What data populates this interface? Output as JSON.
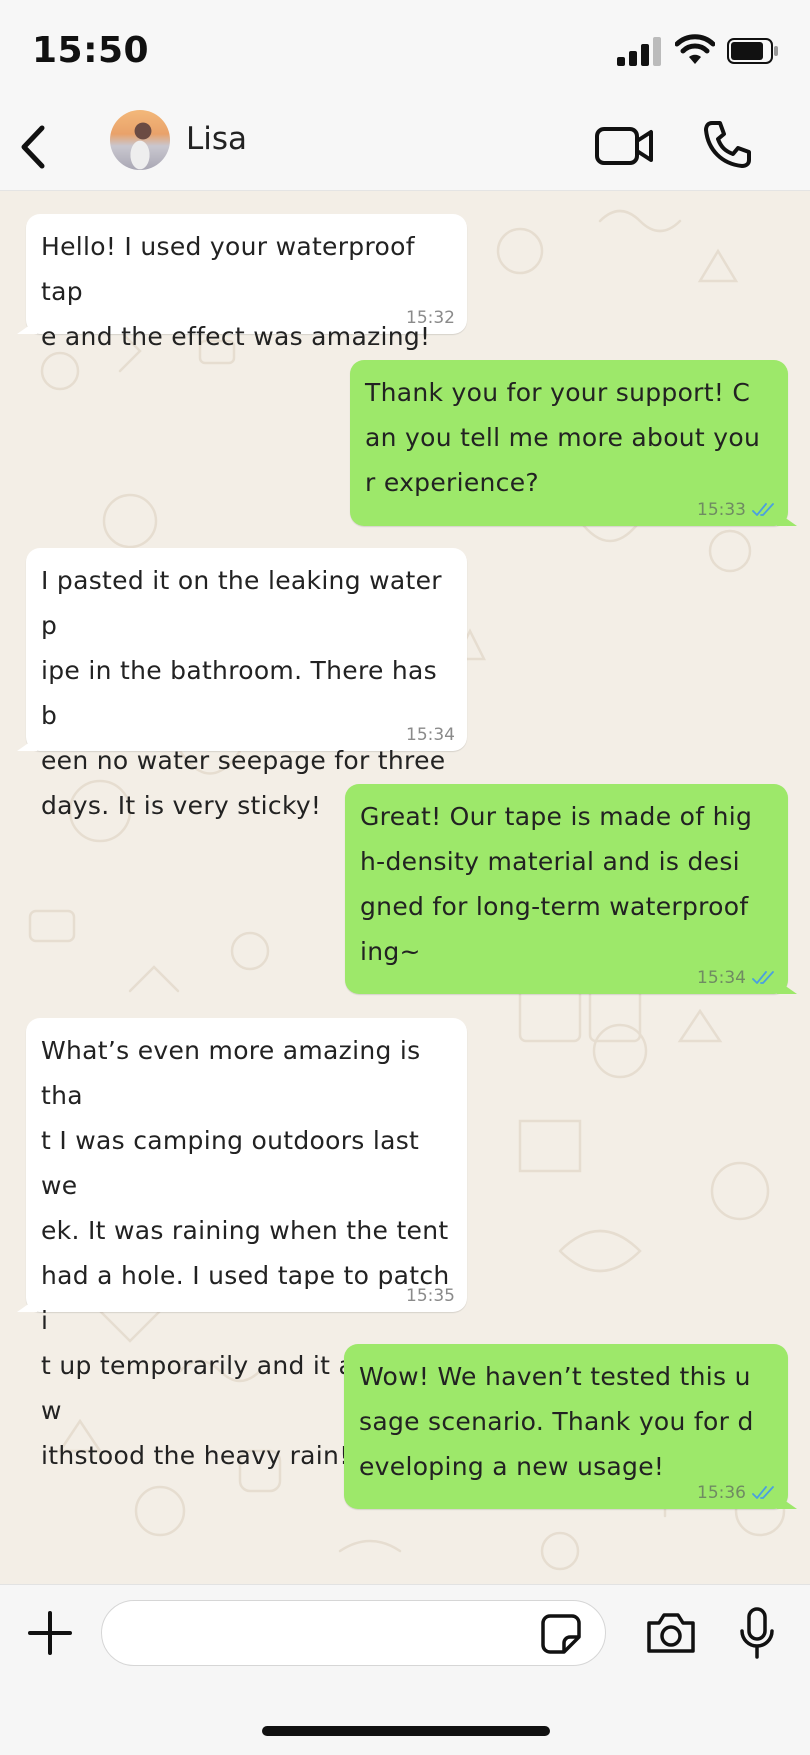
{
  "status_bar": {
    "time": "15:50"
  },
  "header": {
    "contact_name": "Lisa"
  },
  "messages": [
    {
      "dir": "in",
      "text": "Hello! I used your waterproof tap\ne and the effect was amazing!",
      "time": "15:32"
    },
    {
      "dir": "out",
      "text": "Thank you for your support! C\nan you tell me more about you\nr experience?",
      "time": "15:33",
      "read": true
    },
    {
      "dir": "in",
      "text": "I pasted it on the leaking water p\nipe in the bathroom. There has b\neen no water seepage for three\ndays. It is very sticky!",
      "time": "15:34"
    },
    {
      "dir": "out",
      "text": "Great! Our tape is made of hig\nh-density material and is desi\ngned for long-term waterproof\ning~",
      "time": "15:34",
      "read": true
    },
    {
      "dir": "in",
      "text": "What’s even more amazing is tha\nt I was camping outdoors last we\nek. It was raining when the tent\nhad a hole. I used tape to patch i\nt up temporarily and it actually w\nithstood the heavy rain!",
      "time": "15:35"
    },
    {
      "dir": "out",
      "text": "Wow! We haven’t tested this u\nsage scenario. Thank you for d\neveloping a new usage!",
      "time": "15:36",
      "read": true
    }
  ],
  "input": {
    "placeholder": "",
    "value": ""
  },
  "colors": {
    "incoming_bubble": "#ffffff",
    "outgoing_bubble": "#9de86a",
    "chat_background": "#f3eee6",
    "read_tick": "#4a9fe0"
  }
}
